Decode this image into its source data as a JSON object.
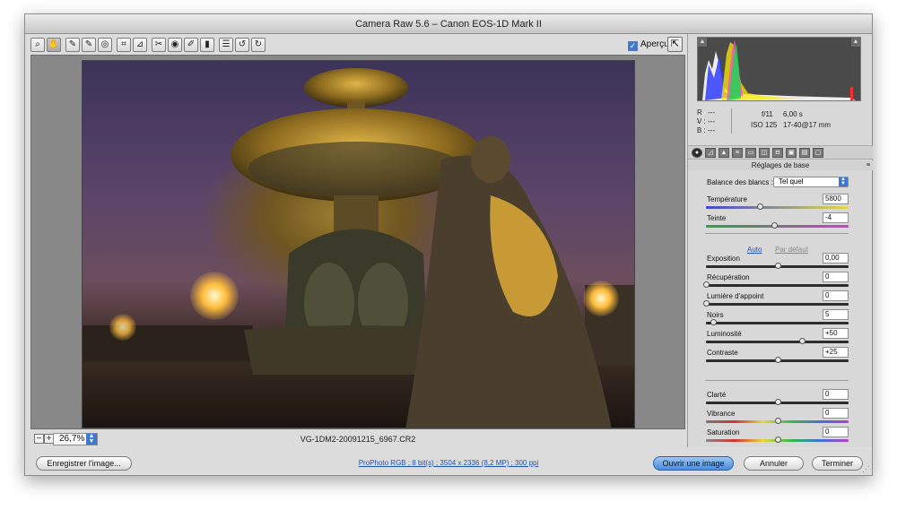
{
  "window": {
    "title": "Camera Raw 5.6  –  Canon EOS-1D Mark II"
  },
  "toolbar": {
    "tools": [
      {
        "name": "zoom-tool-icon",
        "glyph": "⌕"
      },
      {
        "name": "hand-tool-icon",
        "glyph": "✋"
      },
      {
        "name": "white-balance-tool-icon",
        "glyph": "✎"
      },
      {
        "name": "color-sampler-tool-icon",
        "glyph": "✎"
      },
      {
        "name": "targeted-adjustment-tool-icon",
        "glyph": "◎"
      },
      {
        "name": "crop-tool-icon",
        "glyph": "⌗"
      },
      {
        "name": "straighten-tool-icon",
        "glyph": "⊿"
      },
      {
        "name": "spot-removal-tool-icon",
        "glyph": "✂"
      },
      {
        "name": "red-eye-tool-icon",
        "glyph": "◉"
      },
      {
        "name": "adjustment-brush-icon",
        "glyph": "✐"
      },
      {
        "name": "graduated-filter-icon",
        "glyph": "▮"
      },
      {
        "name": "preferences-icon",
        "glyph": "☰"
      },
      {
        "name": "rotate-left-icon",
        "glyph": "↺"
      },
      {
        "name": "rotate-right-icon",
        "glyph": "↻"
      }
    ],
    "preview_label": "Aperçu",
    "preview_checked": true
  },
  "status": {
    "zoom": "26,7%",
    "filename": "VG-1DM2-20091215_6967.CR2"
  },
  "histogram": {
    "readout": {
      "r_label": "R :",
      "r_value": "---",
      "v_label": "V :",
      "v_value": "---",
      "b_label": "B :",
      "b_value": "---",
      "aperture": "f/11",
      "shutter": "6,00 s",
      "iso": "ISO 125",
      "lens": "17-40@17 mm"
    }
  },
  "panel": {
    "title": "Réglages de base",
    "white_balance_label": "Balance des blancs :",
    "white_balance_value": "Tel quel",
    "link_auto": "Auto",
    "link_default": "Par défaut",
    "sliders": [
      {
        "label": "Température",
        "value": "5800",
        "level": 0.38
      },
      {
        "label": "Teinte",
        "value": "-4",
        "level": 0.48
      },
      {
        "label": "Exposition",
        "value": "0,00",
        "level": 0.5
      },
      {
        "label": "Récupération",
        "value": "0",
        "level": 0.0
      },
      {
        "label": "Lumière d'appoint",
        "value": "0",
        "level": 0.0
      },
      {
        "label": "Noirs",
        "value": "5",
        "level": 0.05
      },
      {
        "label": "Luminosité",
        "value": "+50",
        "level": 0.67
      },
      {
        "label": "Contraste",
        "value": "+25",
        "level": 0.5
      },
      {
        "label": "Clarté",
        "value": "0",
        "level": 0.5
      },
      {
        "label": "Vibrance",
        "value": "0",
        "level": 0.5
      },
      {
        "label": "Saturation",
        "value": "0",
        "level": 0.5
      }
    ]
  },
  "bottom": {
    "save_label": "Enregistrer l'image...",
    "workflow": "ProPhoto RGB ; 8 bit(s) ; 3504 x 2336 (8,2 MP) ; 300 ppi",
    "open_label": "Ouvrir une image",
    "cancel_label": "Annuler",
    "done_label": "Terminer"
  },
  "colors": {
    "accent": "#3d79d3",
    "temperature_track_left": "#3b4bd1",
    "temperature_track_right": "#e6d84a",
    "tint_track_left": "#27a83a",
    "tint_track_right": "#d43ad0"
  }
}
